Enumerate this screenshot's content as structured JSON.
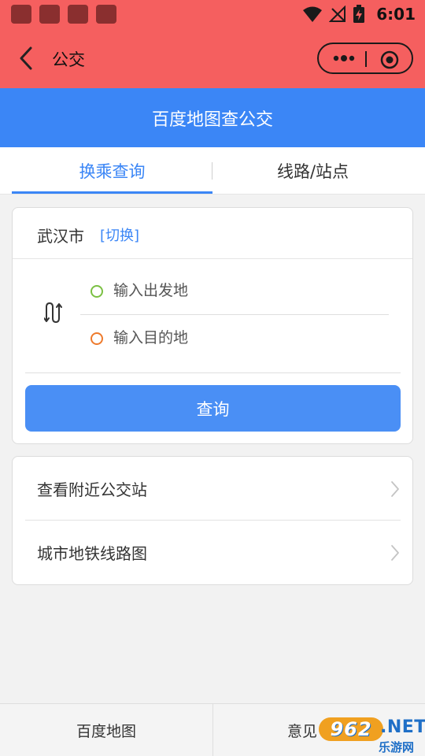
{
  "status_bar": {
    "time": "6:01",
    "icons": [
      "notification-icon",
      "notification-icon",
      "notification-icon",
      "notification-icon",
      "wifi-icon",
      "no-signal-icon",
      "battery-charging-icon"
    ]
  },
  "title_bar": {
    "title": "公交",
    "back_icon": "back-arrow-icon",
    "more_icon": "more-dots-icon",
    "close_icon": "close-target-icon"
  },
  "header": {
    "title": "百度地图查公交"
  },
  "tabs": [
    {
      "label": "换乘查询",
      "active": true
    },
    {
      "label": "线路/站点",
      "active": false
    }
  ],
  "transfer": {
    "city": "武汉市",
    "switch_label": "[切换]",
    "start_placeholder": "输入出发地",
    "end_placeholder": "输入目的地",
    "query_label": "查询"
  },
  "links": [
    {
      "label": "查看附近公交站"
    },
    {
      "label": "城市地铁线路图"
    }
  ],
  "bottom_bar": {
    "left_label": "百度地图",
    "right_label": "意见"
  },
  "watermark": {
    "badge": "962",
    "net": ".NET",
    "sub": "乐游网"
  },
  "colors": {
    "status_title_bg": "#f55f5f",
    "header_blue": "#3b86f6",
    "button_blue": "#4a8ff5",
    "start_dot": "#7bc043",
    "end_dot": "#ee7a2c"
  }
}
